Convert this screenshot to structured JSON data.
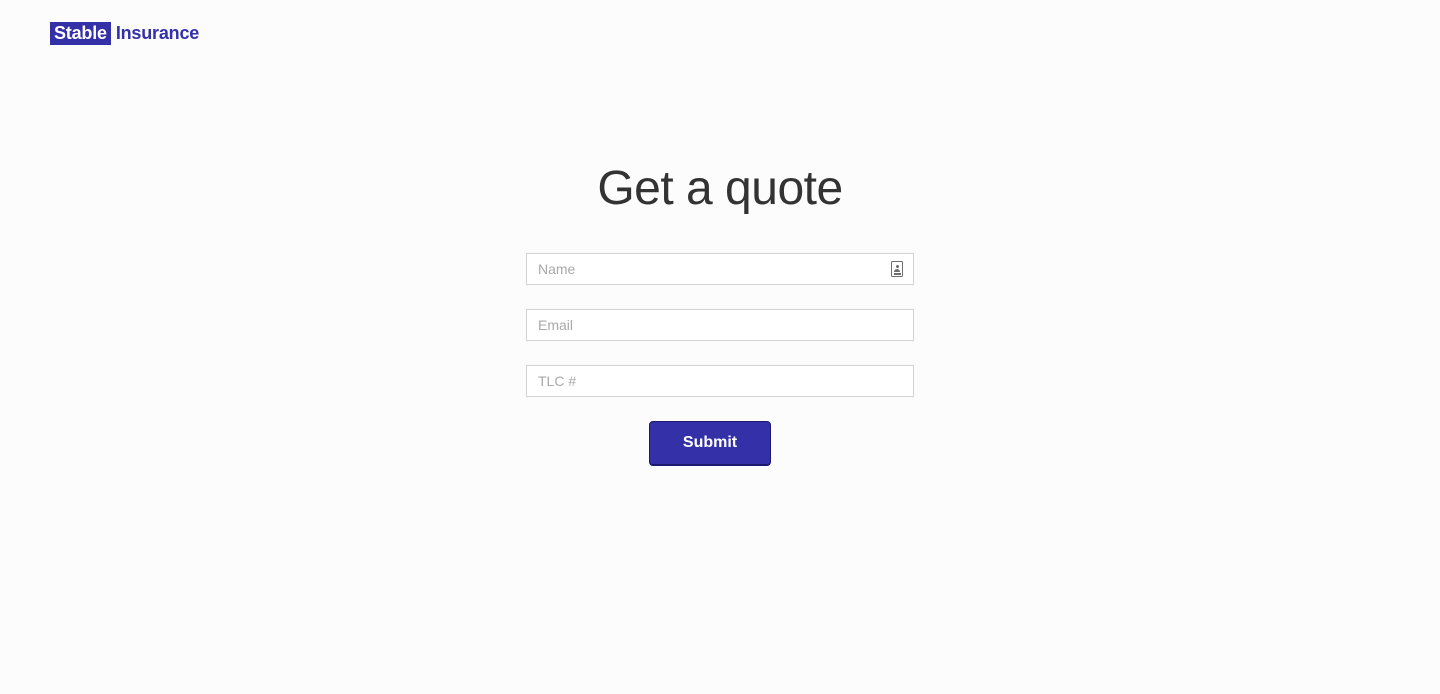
{
  "header": {
    "logo_boxed": "Stable",
    "logo_text": "Insurance"
  },
  "main": {
    "title": "Get a quote",
    "form": {
      "name_placeholder": "Name",
      "email_placeholder": "Email",
      "tlc_placeholder": "TLC #",
      "submit_label": "Submit"
    }
  },
  "colors": {
    "brand": "#3430a8",
    "background": "#fdfcfd",
    "text": "#333333"
  },
  "icons": {
    "name_field_icon": "contact-card-icon"
  }
}
